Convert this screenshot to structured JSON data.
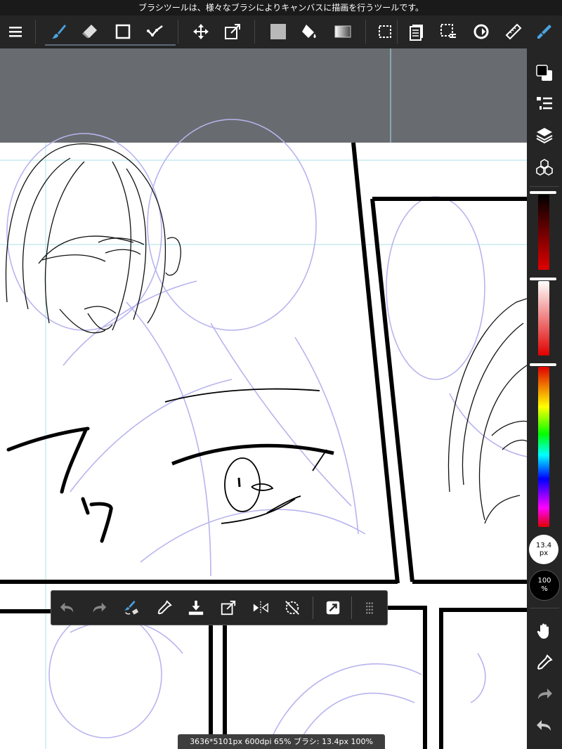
{
  "tooltip": "ブラシツールは、様々なブラシによりキャンバスに描画を行うツールです。",
  "toolbar": {
    "items": [
      {
        "name": "menu-button",
        "icon": "hamburger-menu-icon"
      },
      {
        "name": "brush-tool-button",
        "icon": "brush-icon",
        "active": true
      },
      {
        "name": "eraser-tool-button",
        "icon": "eraser-icon"
      },
      {
        "name": "shape-tool-button",
        "icon": "square-icon"
      },
      {
        "name": "operation-tool-button",
        "icon": "check-path-icon"
      },
      {
        "name": "move-tool-button",
        "icon": "move-arrows-icon"
      },
      {
        "name": "transform-tool-button",
        "icon": "transform-icon"
      },
      {
        "name": "fill-color-button",
        "icon": "gray-square-icon"
      },
      {
        "name": "bucket-tool-button",
        "icon": "paint-bucket-icon"
      },
      {
        "name": "gradient-tool-button",
        "icon": "gradient-icon"
      },
      {
        "name": "select-tool-button",
        "icon": "dotted-select-icon"
      },
      {
        "name": "copy-layer-button",
        "icon": "copy-pages-icon"
      },
      {
        "name": "selection-menu-button",
        "icon": "selection-list-icon"
      },
      {
        "name": "rotate-view-button",
        "icon": "rotate-icon"
      },
      {
        "name": "ruler-button",
        "icon": "ruler-icon"
      },
      {
        "name": "brush-settings-button",
        "icon": "brush-pen-icon"
      }
    ]
  },
  "right_panel": {
    "brush_size": {
      "value": "13.4",
      "unit": "px"
    },
    "opacity": {
      "value": "100",
      "unit": "%"
    },
    "icons": [
      "color-swatch-icon",
      "layer-list-icon",
      "layers-icon",
      "materials-icon",
      "hand-icon",
      "eyedropper-icon",
      "redo-icon",
      "undo-icon"
    ],
    "colors": {
      "accent": "#4aa3df",
      "red": "#e00000"
    }
  },
  "float_bar": {
    "icons": [
      "undo-icon",
      "redo-icon",
      "brush-swap-icon",
      "eyedropper-icon",
      "save-download-icon",
      "export-icon",
      "flip-icon",
      "no-rotate-icon",
      "share-icon",
      "grip-dots-icon"
    ]
  },
  "status": "3636*5101px 600dpi 65% ブラシ: 13.4px 100%"
}
